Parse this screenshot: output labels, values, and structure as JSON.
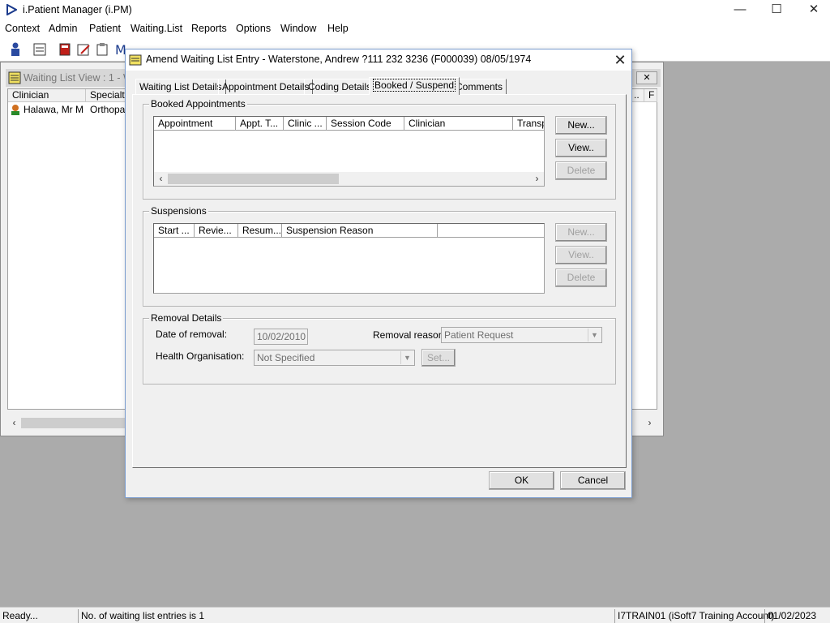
{
  "app": {
    "title": "i.Patient Manager (i.PM)"
  },
  "window_controls": {
    "minimize": "—",
    "maximize": "☐",
    "close": "✕"
  },
  "menu": [
    "Context",
    "Admin",
    "Patient",
    "Waiting.List",
    "Reports",
    "Options",
    "Window",
    "Help"
  ],
  "background_window": {
    "title": "Waiting List View : 1 - W",
    "columns": [
      "Clinician",
      "Specialty",
      "..",
      "F"
    ],
    "rows": [
      {
        "clinician": "Halawa, Mr M",
        "specialty": "Orthopae"
      }
    ]
  },
  "dialog": {
    "title": "Amend Waiting List Entry - Waterstone, Andrew ?111 232 3236 (F000039) 08/05/1974",
    "tabs": [
      "Waiting List Details",
      "Appointment Details",
      "Coding Details",
      "Booked / Suspend",
      "Comments"
    ],
    "active_tab": "Booked / Suspend",
    "booked": {
      "label": "Booked Appointments",
      "columns": [
        "Appointment",
        "Appt. T...",
        "Clinic ...",
        "Session Code",
        "Clinician",
        "Transp"
      ],
      "buttons": {
        "new": "New...",
        "view": "View..",
        "delete": "Delete"
      }
    },
    "suspensions": {
      "label": "Suspensions",
      "columns": [
        "Start ...",
        "Revie...",
        "Resum...",
        "Suspension Reason",
        ""
      ],
      "buttons": {
        "new": "New...",
        "view": "View..",
        "delete": "Delete"
      }
    },
    "removal": {
      "label": "Removal Details",
      "date_label": "Date of removal:",
      "date_value": "10/02/2010",
      "reason_label": "Removal reason:",
      "reason_value": "Patient Request",
      "health_org_label": "Health Organisation:",
      "health_org_value": "Not Specified",
      "set_button": "Set..."
    },
    "ok": "OK",
    "cancel": "Cancel"
  },
  "status": {
    "ready": "Ready...",
    "entries": "No. of waiting list entries is 1",
    "user": "I7TRAIN01 (iSoft7 Training Account)",
    "date": "01/02/2023"
  },
  "colors": {
    "desktop": "#ababab",
    "dialog_border": "#7a9ccf",
    "app_icon": "#1a3a8c"
  }
}
